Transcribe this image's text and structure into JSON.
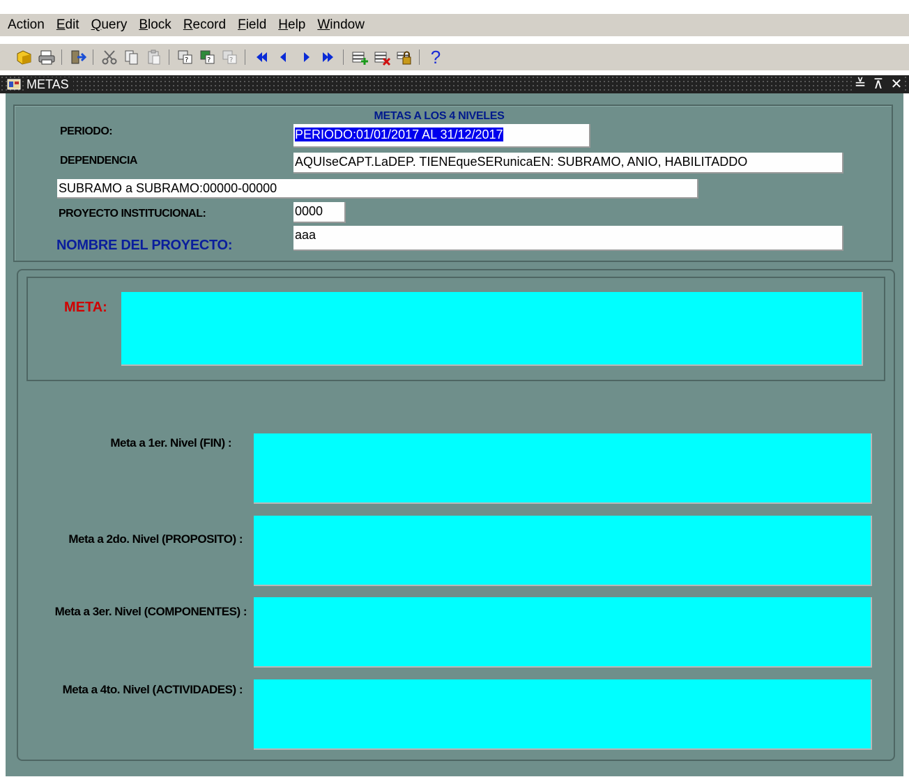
{
  "menu": [
    {
      "mnemonic": "",
      "rest": "Action"
    },
    {
      "mnemonic": "E",
      "rest": "dit"
    },
    {
      "mnemonic": "Q",
      "rest": "uery"
    },
    {
      "mnemonic": "B",
      "rest": "lock"
    },
    {
      "mnemonic": "R",
      "rest": "ecord"
    },
    {
      "mnemonic": "F",
      "rest": "ield"
    },
    {
      "mnemonic": "H",
      "rest": "elp"
    },
    {
      "mnemonic": "W",
      "rest": "indow"
    }
  ],
  "toolbar": {
    "icons": [
      "save-icon",
      "print-icon",
      "exit-icon",
      "cut-icon",
      "copy-icon",
      "paste-icon",
      "enter-query-icon",
      "execute-query-icon",
      "cancel-query-icon",
      "previous-block-icon",
      "previous-record-icon",
      "next-record-icon",
      "next-block-icon",
      "insert-record-icon",
      "delete-record-icon",
      "lock-record-icon",
      "help-icon"
    ],
    "help_glyph": "?"
  },
  "window": {
    "title": "METAS",
    "controls": [
      "≚",
      "⊼",
      "✕"
    ]
  },
  "form": {
    "heading": "METAS A LOS 4 NIVELES",
    "periodo_label": "PERIODO:",
    "periodo_value": "PERIODO:01/01/2017 AL 31/12/2017",
    "dependencia_label": "DEPENDENCIA",
    "dependencia_value": "AQUIseCAPT.LaDEP. TIENEqueSERunicaEN: SUBRAMO, ANIO, HABILITADDO",
    "subramo_value": "SUBRAMO a SUBRAMO:00000-00000",
    "proyecto_label": "PROYECTO INSTITUCIONAL:",
    "proyecto_value": "0000",
    "nombre_label": "NOMBRE DEL PROYECTO:",
    "nombre_value": "aaa"
  },
  "metas": {
    "meta_label": "META:",
    "meta_value": "",
    "nivel1_label": "Meta a 1er. Nivel (FIN) :",
    "nivel1_value": "",
    "nivel2_label": "Meta a 2do. Nivel (PROPOSITO) :",
    "nivel2_value": "",
    "nivel3_label": "Meta a 3er. Nivel (COMPONENTES) :",
    "nivel3_value": "",
    "nivel4_label": "Meta a 4to. Nivel (ACTIVIDADES) :",
    "nivel4_value": ""
  },
  "colors": {
    "form_bg": "#6f8f8b",
    "text_area": "#00ffff",
    "selection": "#0000ee",
    "label_red": "#d00000",
    "label_blue": "#0a1e9c"
  }
}
